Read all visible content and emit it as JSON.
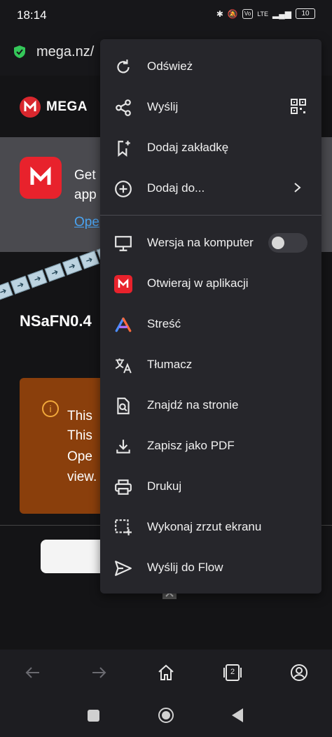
{
  "status_bar": {
    "time": "18:14",
    "network": "LTE",
    "battery": "10"
  },
  "url_bar": {
    "url": "mega.nz/"
  },
  "page": {
    "brand": "MEGA",
    "banner": {
      "line1": "Get",
      "line2": "app",
      "link": "Ope"
    },
    "file_name": "NSaFN0.4",
    "warning": {
      "lines": [
        "This",
        "This",
        "Ope",
        "view."
      ]
    }
  },
  "menu": {
    "items": [
      {
        "label": "Odśwież",
        "icon": "refresh-icon"
      },
      {
        "label": "Wyślij",
        "icon": "share-icon"
      },
      {
        "label": "Dodaj zakładkę",
        "icon": "bookmark-add-icon"
      },
      {
        "label": "Dodaj do...",
        "icon": "add-circle-icon"
      },
      {
        "label": "Wersja na komputer",
        "icon": "desktop-icon"
      },
      {
        "label": "Otwieraj w aplikacji",
        "icon": "mega-app-icon"
      },
      {
        "label": "Streść",
        "icon": "summarize-icon"
      },
      {
        "label": "Tłumacz",
        "icon": "translate-icon"
      },
      {
        "label": "Znajdź na stronie",
        "icon": "find-in-page-icon"
      },
      {
        "label": "Zapisz jako PDF",
        "icon": "download-icon"
      },
      {
        "label": "Drukuj",
        "icon": "print-icon"
      },
      {
        "label": "Wykonaj zrzut ekranu",
        "icon": "screenshot-icon"
      },
      {
        "label": "Wyślij do Flow",
        "icon": "send-icon"
      }
    ],
    "desktop_toggle": false
  },
  "bottom_nav": {
    "tab_count": "2"
  },
  "colors": {
    "menu_bg": "#26262b",
    "mega_red": "#d9272e",
    "link": "#4aa3f0",
    "warning_bg": "#8a3f0c"
  }
}
